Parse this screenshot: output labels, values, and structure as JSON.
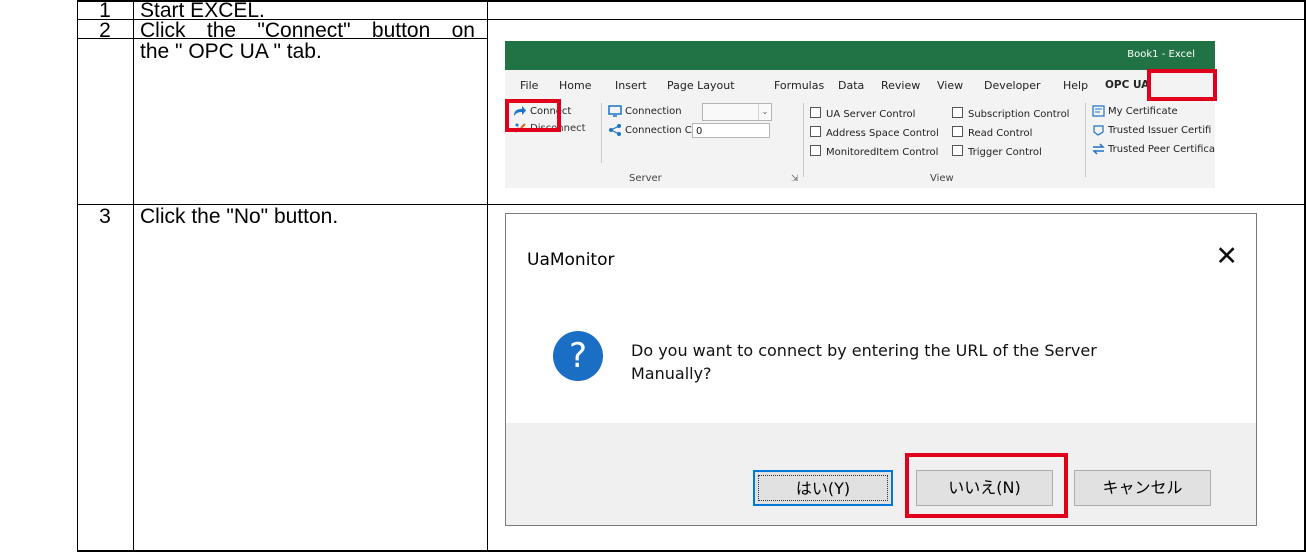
{
  "steps": [
    {
      "num": "1",
      "desc_lines": [
        "Start EXCEL."
      ]
    },
    {
      "num": "2",
      "desc_lines": [
        "Click the \"Connect\" button on",
        "the \" OPC UA \" tab."
      ]
    },
    {
      "num": "3",
      "desc_lines": [
        "Click the \"No\" button."
      ]
    }
  ],
  "excel": {
    "window_title": "Book1  -  Excel",
    "tabs": [
      "File",
      "Home",
      "Insert",
      "Page Layout",
      "Formulas",
      "Data",
      "Review",
      "View",
      "Developer",
      "Help",
      "OPC UA"
    ],
    "active_tab": "OPC UA",
    "server_group": {
      "label": "Server",
      "connect": "Connect",
      "disconnect": "Disconnect",
      "connection": "Connection",
      "connection_value": "",
      "connection_count": "Connection Count",
      "connection_count_value": "0"
    },
    "view_group": {
      "label": "View",
      "checkboxes": [
        "UA Server Control",
        "Address Space Control",
        "MonitoredItem Control",
        "Subscription Control",
        "Read Control",
        "Trigger Control"
      ]
    },
    "cert_group": {
      "items": [
        "My Certificate",
        "Trusted Issuer Certifi",
        "Trusted Peer Certifica"
      ]
    },
    "colors": {
      "title_bar": "#217346",
      "highlight": "#e0001b"
    }
  },
  "dialog": {
    "title": "UaMonitor",
    "close_glyph": "✕",
    "icon_glyph": "?",
    "message_lines": [
      "Do you want to connect by entering the URL of the Server",
      "Manually?"
    ],
    "buttons": {
      "yes": "はい(Y)",
      "no": "いいえ(N)",
      "cancel": "キャンセル"
    },
    "colors": {
      "icon": "#1a6fc4",
      "default_button_border": "#0078d7"
    }
  }
}
